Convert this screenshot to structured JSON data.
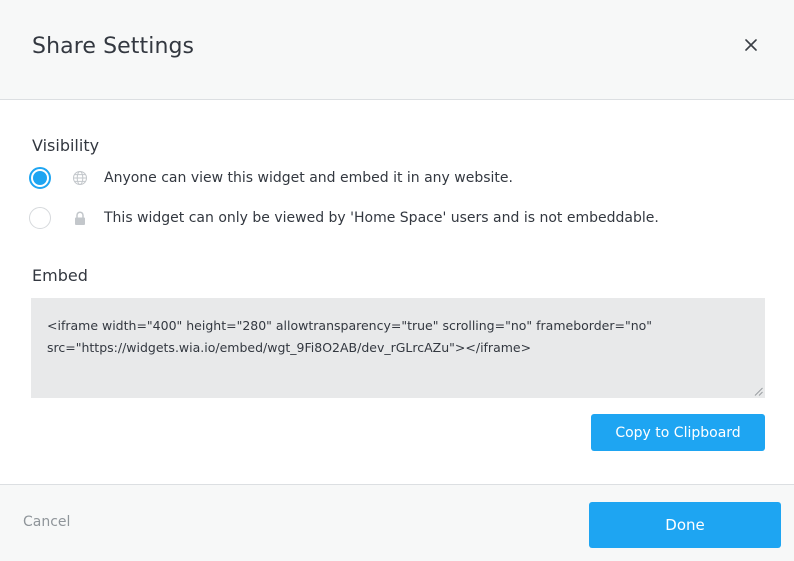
{
  "header": {
    "title": "Share Settings",
    "close_icon": "close-icon"
  },
  "visibility": {
    "label": "Visibility",
    "options": [
      {
        "text": "Anyone can view this widget and embed it in any website.",
        "icon": "globe-icon",
        "selected": true
      },
      {
        "text": "This widget can only be viewed by 'Home Space' users and is not embeddable.",
        "icon": "lock-icon",
        "selected": false
      }
    ]
  },
  "embed": {
    "label": "Embed",
    "code": "<iframe width=\"400\" height=\"280\" allowtransparency=\"true\" scrolling=\"no\" frameborder=\"no\" src=\"https://widgets.wia.io/embed/wgt_9Fi8O2AB/dev_rGLrcAZu\"></iframe>",
    "copy_label": "Copy to Clipboard"
  },
  "footer": {
    "cancel_label": "Cancel",
    "done_label": "Done"
  },
  "colors": {
    "accent": "#1ea5f2",
    "header_bg": "#f7f8f8",
    "embed_bg": "#e8e9ea",
    "text": "#333840",
    "muted": "#8f959a"
  }
}
